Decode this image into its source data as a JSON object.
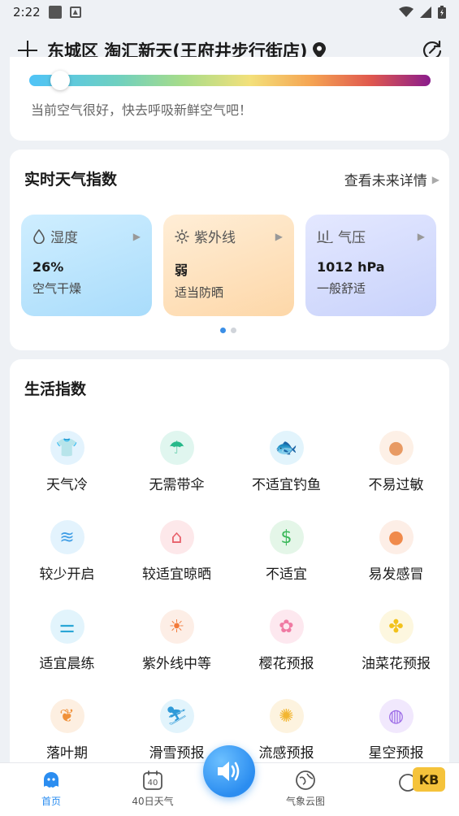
{
  "status_bar": {
    "time": "2:22"
  },
  "header": {
    "location": "东城区 淘汇新天(王府井步行街店)"
  },
  "aqi": {
    "message": "当前空气很好，快去呼吸新鲜空气吧！",
    "level": 0.06
  },
  "weather_index": {
    "title": "实时天气指数",
    "more": "查看未来详情",
    "cards": [
      {
        "name": "湿度",
        "value": "26%",
        "desc": "空气干燥",
        "icon": "droplet-icon"
      },
      {
        "name": "紫外线",
        "value": "弱",
        "desc": "适当防晒",
        "icon": "sun-icon"
      },
      {
        "name": "气压",
        "value": "1012 hPa",
        "desc": "一般舒适",
        "icon": "pressure-icon"
      }
    ]
  },
  "life_index": {
    "title": "生活指数",
    "items": [
      {
        "label": "天气冷",
        "icon": "coat-icon",
        "bg": "#e3f3fd",
        "color": "#4aa8e8"
      },
      {
        "label": "无需带伞",
        "icon": "umbrella-icon",
        "bg": "#e0f6ef",
        "color": "#27b98a"
      },
      {
        "label": "不适宜钓鱼",
        "icon": "fish-icon",
        "bg": "#e2f4fc",
        "color": "#3aa5d8"
      },
      {
        "label": "不易过敏",
        "icon": "cookie-icon",
        "bg": "#fdf0e6",
        "color": "#e89a63"
      },
      {
        "label": "较少开启",
        "icon": "air-conditioner-icon",
        "bg": "#e3f3fd",
        "color": "#3f9ee6"
      },
      {
        "label": "较适宜晾晒",
        "icon": "drying-rack-icon",
        "bg": "#fde8ea",
        "color": "#e8606a"
      },
      {
        "label": "不适宜",
        "icon": "money-icon",
        "bg": "#e4f6e8",
        "color": "#3bb85a"
      },
      {
        "label": "易发感冒",
        "icon": "pill-icon",
        "bg": "#fdeee6",
        "color": "#f08a4b"
      },
      {
        "label": "适宜晨练",
        "icon": "dumbbell-icon",
        "bg": "#e2f4fc",
        "color": "#2aa6d6"
      },
      {
        "label": "紫外线中等",
        "icon": "sun-icon",
        "bg": "#fdeee6",
        "color": "#f27a3a"
      },
      {
        "label": "樱花预报",
        "icon": "sakura-icon",
        "bg": "#fde8ef",
        "color": "#f07aa3"
      },
      {
        "label": "油菜花预报",
        "icon": "rapeseed-flower-icon",
        "bg": "#fdf7df",
        "color": "#f2c21c"
      },
      {
        "label": "落叶期",
        "icon": "maple-leaf-icon",
        "bg": "#fdefe1",
        "color": "#f0913a"
      },
      {
        "label": "滑雪预报",
        "icon": "skier-icon",
        "bg": "#e2f4fc",
        "color": "#2f9ad8"
      },
      {
        "label": "流感预报",
        "icon": "virus-icon",
        "bg": "#fdf3df",
        "color": "#f2b632"
      },
      {
        "label": "星空预报",
        "icon": "planet-icon",
        "bg": "#f1e8fd",
        "color": "#9b6ae6"
      }
    ]
  },
  "bottom_nav": {
    "items": [
      {
        "label": "首页",
        "icon": "home-icon"
      },
      {
        "label": "40日天气",
        "icon": "calendar-40-icon",
        "badge": "40"
      },
      {
        "label": "气象云图",
        "icon": "cloud-map-icon"
      }
    ],
    "voice_icon": "speaker-icon",
    "badge_text": "KB"
  },
  "colors": {
    "accent": "#2b8df0"
  }
}
